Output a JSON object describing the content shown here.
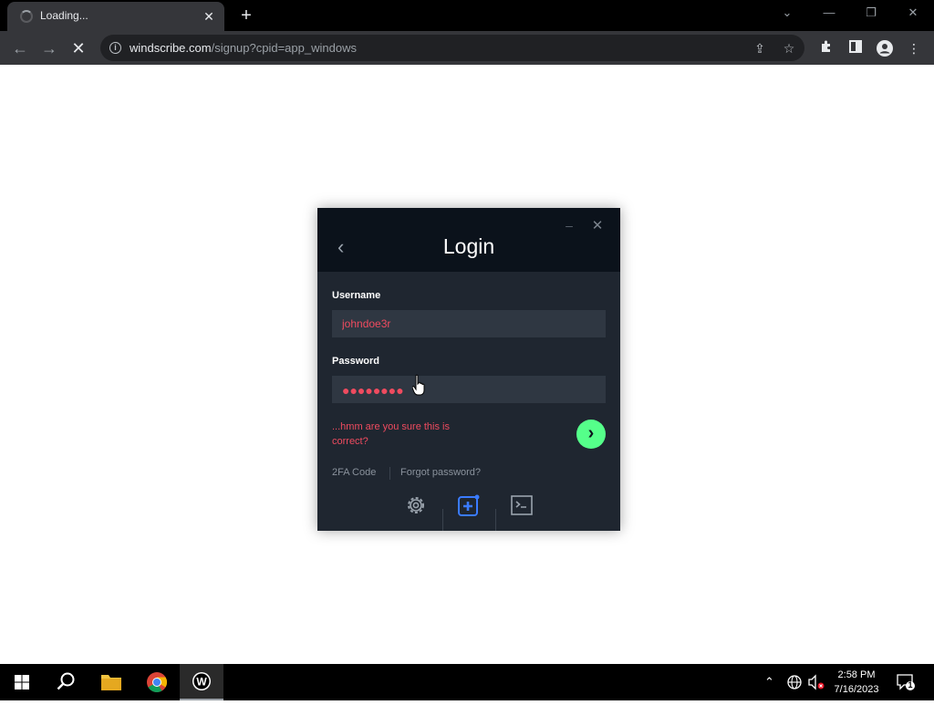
{
  "browser": {
    "tab_title": "Loading...",
    "tab_close": "✕",
    "new_tab": "+",
    "url_host": "windscribe.com",
    "url_path": "/signup?cpid=app_windows",
    "window_controls": [
      "⌄",
      "—",
      "❐",
      "✕"
    ],
    "nav": {
      "back": "←",
      "forward": "→",
      "stop": "✕"
    }
  },
  "login": {
    "title": "Login",
    "username_label": "Username",
    "username_value": "johndoe3r",
    "password_label": "Password",
    "password_dots": "●●●●●●●●",
    "error_text": "...hmm are you sure this is correct?",
    "twofa_link": "2FA Code",
    "forgot_link": "Forgot password?",
    "accent_color": "#55ff8a",
    "error_color": "#ef4b5f",
    "bottom_icons": [
      "gear-icon",
      "add-config-icon",
      "terminal-icon"
    ]
  },
  "taskbar": {
    "time": "2:58 PM",
    "date": "7/16/2023",
    "notification_count": "1",
    "apps": [
      "start-icon",
      "search-icon",
      "file-explorer-icon",
      "chrome-icon",
      "windscribe-icon"
    ]
  }
}
